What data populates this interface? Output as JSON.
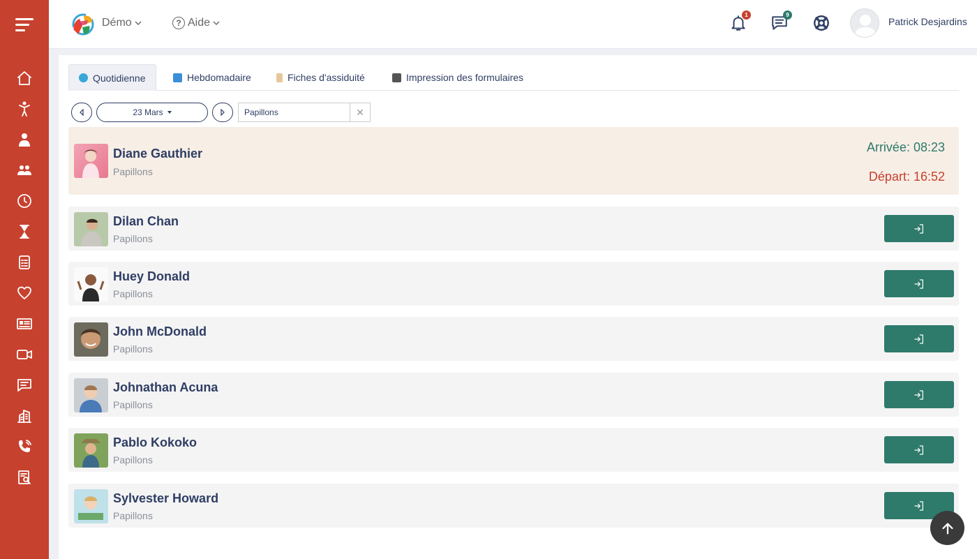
{
  "header": {
    "org_menu": "Démo",
    "help_menu": "Aide",
    "notifications_count": "1",
    "messages_count": "9",
    "user_name": "Patrick Desjardins"
  },
  "tabs": [
    {
      "label": "Quotidienne",
      "icon": "clock-icon",
      "active": true
    },
    {
      "label": "Hebdomadaire",
      "icon": "calendar-icon"
    },
    {
      "label": "Fiches d'assiduité",
      "icon": "hand-icon"
    },
    {
      "label": "Impression des formulaires",
      "icon": "printer-icon"
    }
  ],
  "controls": {
    "date": "23 Mars",
    "group": "Papillons"
  },
  "children": [
    {
      "name": "Diane Gauthier",
      "group": "Papillons",
      "arrival": "Arrivée: 08:23",
      "departure": "Départ: 16:52"
    },
    {
      "name": "Dilan Chan",
      "group": "Papillons"
    },
    {
      "name": "Huey Donald",
      "group": "Papillons"
    },
    {
      "name": "John McDonald",
      "group": "Papillons"
    },
    {
      "name": "Johnathan Acuna",
      "group": "Papillons"
    },
    {
      "name": "Pablo Kokoko",
      "group": "Papillons"
    },
    {
      "name": "Sylvester Howard",
      "group": "Papillons"
    }
  ],
  "colors": {
    "sidebar": "#c7412f",
    "accent": "#2e7a6b",
    "navy": "#2f3e64",
    "departure": "#c7412f"
  }
}
